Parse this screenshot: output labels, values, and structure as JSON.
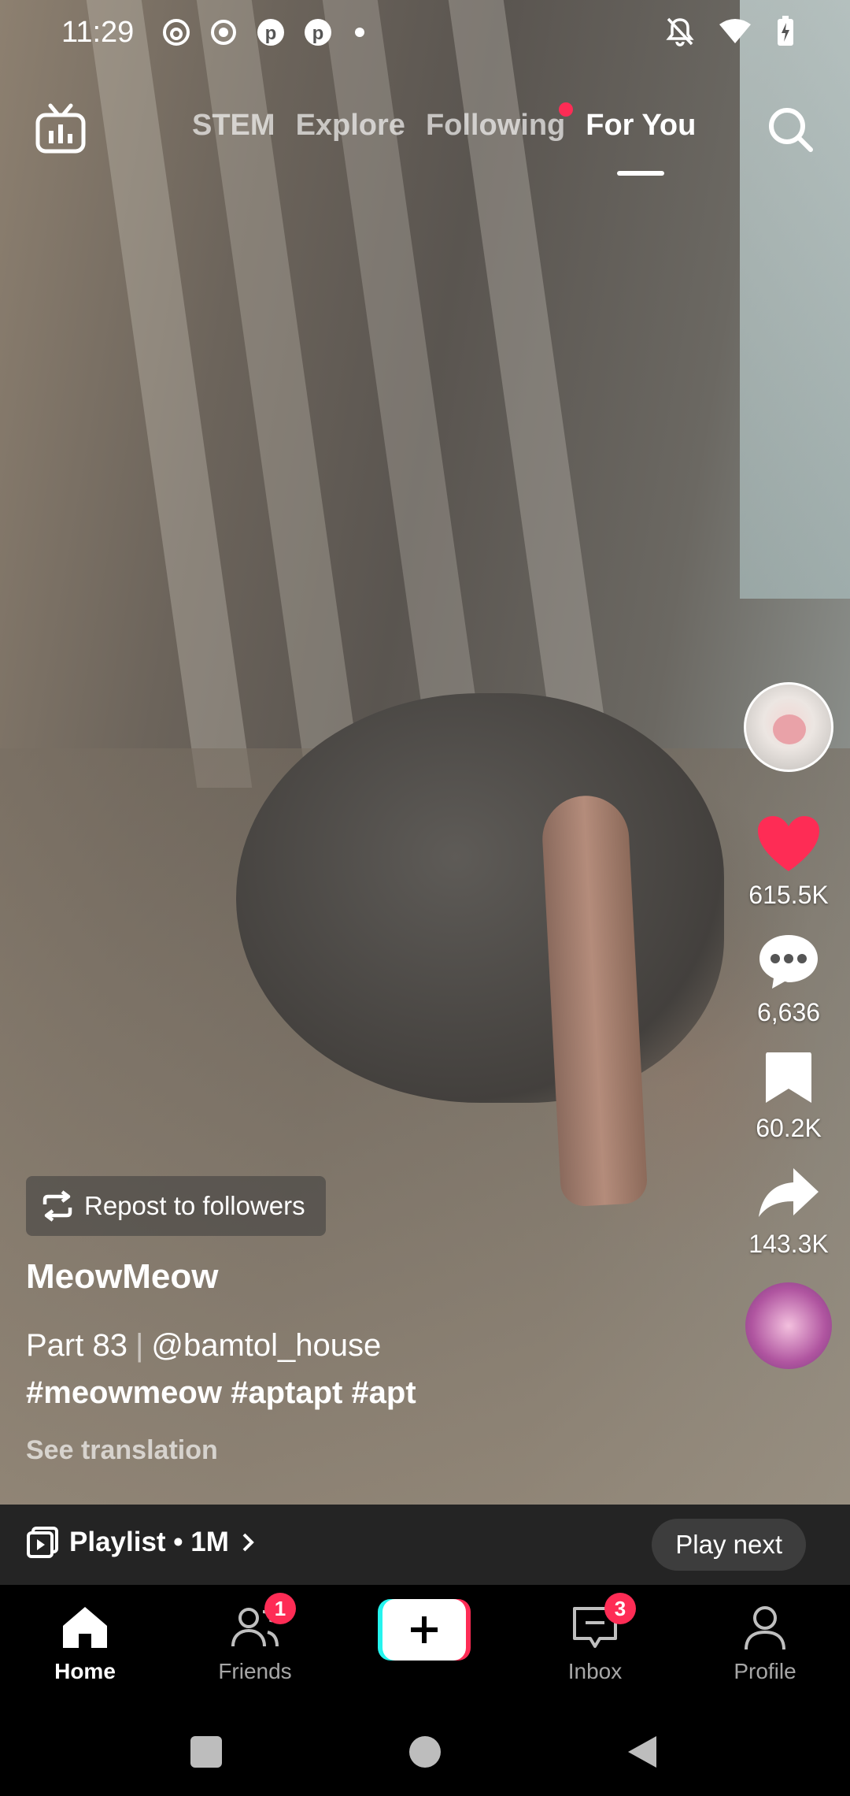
{
  "status_bar": {
    "time": "11:29",
    "left_icons": [
      "threads-icon",
      "record-icon",
      "pinterest-icon",
      "pinterest-icon",
      "dot-icon"
    ],
    "right_icons": [
      "bell-off-icon",
      "wifi-icon",
      "battery-charging-icon"
    ]
  },
  "top_nav": {
    "tabs": [
      {
        "label": "STEM",
        "active": false
      },
      {
        "label": "Explore",
        "active": false
      },
      {
        "label": "Following",
        "active": false,
        "has_dot": true
      },
      {
        "label": "For You",
        "active": true
      }
    ]
  },
  "rail": {
    "likes": "615.5K",
    "comments": "6,636",
    "saves": "60.2K",
    "shares": "143.3K"
  },
  "caption": {
    "repost_label": "Repost to followers",
    "author": "MeowMeow",
    "part": "Part 83",
    "separator": "|",
    "mention": "@bamtol_house",
    "hashtags": "#meowmeow #aptapt #apt",
    "see_translation": "See translation"
  },
  "playlist": {
    "label": "Playlist • 1M",
    "play_next": "Play next"
  },
  "bottom_nav": {
    "home": "Home",
    "friends": "Friends",
    "friends_badge": "1",
    "inbox": "Inbox",
    "inbox_badge": "3",
    "profile": "Profile"
  },
  "colors": {
    "accent": "#fe2c55",
    "cyan": "#25f4ee"
  }
}
